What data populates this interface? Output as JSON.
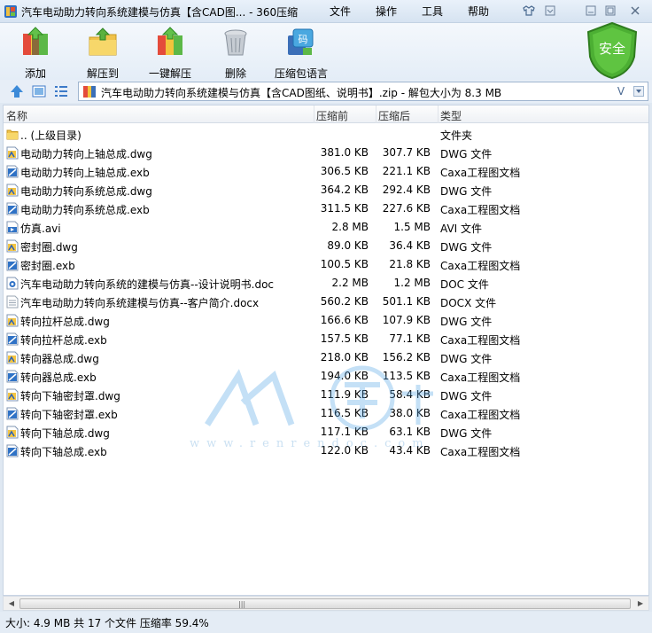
{
  "window": {
    "title": "汽车电动助力转向系统建模与仿真【含CAD图... - 360压缩",
    "menu": [
      "文件",
      "操作",
      "工具",
      "帮助"
    ]
  },
  "toolbar": {
    "buttons": [
      {
        "label": "添加",
        "icon": "add-archive-icon"
      },
      {
        "label": "解压到",
        "icon": "extract-to-icon"
      },
      {
        "label": "一键解压",
        "icon": "one-click-extract-icon"
      },
      {
        "label": "删除",
        "icon": "delete-icon"
      },
      {
        "label": "压缩包语言",
        "icon": "archive-language-icon"
      }
    ],
    "safe_badge": "安全"
  },
  "address": {
    "path": "汽车电动助力转向系统建模与仿真【含CAD图纸、说明书】.zip - 解包大小为 8.3 MB",
    "dropdown": "V"
  },
  "columns": {
    "name": "名称",
    "packed": "压缩前",
    "compressed": "压缩后",
    "type": "类型"
  },
  "files": [
    {
      "name": ".. (上级目录)",
      "packed": "",
      "compressed": "",
      "type": "文件夹",
      "kind": "folder"
    },
    {
      "name": "电动助力转向上轴总成.dwg",
      "packed": "381.0 KB",
      "compressed": "307.7 KB",
      "type": "DWG 文件",
      "kind": "dwg"
    },
    {
      "name": "电动助力转向上轴总成.exb",
      "packed": "306.5 KB",
      "compressed": "221.1 KB",
      "type": "Caxa工程图文档",
      "kind": "exb"
    },
    {
      "name": "电动助力转向系统总成.dwg",
      "packed": "364.2 KB",
      "compressed": "292.4 KB",
      "type": "DWG 文件",
      "kind": "dwg"
    },
    {
      "name": "电动助力转向系统总成.exb",
      "packed": "311.5 KB",
      "compressed": "227.6 KB",
      "type": "Caxa工程图文档",
      "kind": "exb"
    },
    {
      "name": "仿真.avi",
      "packed": "2.8 MB",
      "compressed": "1.5 MB",
      "type": "AVI 文件",
      "kind": "avi"
    },
    {
      "name": "密封圈.dwg",
      "packed": "89.0 KB",
      "compressed": "36.4 KB",
      "type": "DWG 文件",
      "kind": "dwg"
    },
    {
      "name": "密封圈.exb",
      "packed": "100.5 KB",
      "compressed": "21.8 KB",
      "type": "Caxa工程图文档",
      "kind": "exb"
    },
    {
      "name": "汽车电动助力转向系统的建模与仿真--设计说明书.doc",
      "packed": "2.2 MB",
      "compressed": "1.2 MB",
      "type": "DOC 文件",
      "kind": "doc"
    },
    {
      "name": "汽车电动助力转向系统建模与仿真--客户简介.docx",
      "packed": "560.2 KB",
      "compressed": "501.1 KB",
      "type": "DOCX 文件",
      "kind": "docx"
    },
    {
      "name": "转向拉杆总成.dwg",
      "packed": "166.6 KB",
      "compressed": "107.9 KB",
      "type": "DWG 文件",
      "kind": "dwg"
    },
    {
      "name": "转向拉杆总成.exb",
      "packed": "157.5 KB",
      "compressed": "77.1 KB",
      "type": "Caxa工程图文档",
      "kind": "exb"
    },
    {
      "name": "转向器总成.dwg",
      "packed": "218.0 KB",
      "compressed": "156.2 KB",
      "type": "DWG 文件",
      "kind": "dwg"
    },
    {
      "name": "转向器总成.exb",
      "packed": "194.0 KB",
      "compressed": "113.5 KB",
      "type": "Caxa工程图文档",
      "kind": "exb"
    },
    {
      "name": "转向下轴密封罩.dwg",
      "packed": "111.9 KB",
      "compressed": "58.4 KB",
      "type": "DWG 文件",
      "kind": "dwg"
    },
    {
      "name": "转向下轴密封罩.exb",
      "packed": "116.5 KB",
      "compressed": "38.0 KB",
      "type": "Caxa工程图文档",
      "kind": "exb"
    },
    {
      "name": "转向下轴总成.dwg",
      "packed": "117.1 KB",
      "compressed": "63.1 KB",
      "type": "DWG 文件",
      "kind": "dwg"
    },
    {
      "name": "转向下轴总成.exb",
      "packed": "122.0 KB",
      "compressed": "43.4 KB",
      "type": "Caxa工程图文档",
      "kind": "exb"
    }
  ],
  "watermark": {
    "text": "www.renrendoc.com"
  },
  "status": {
    "text": "大小: 4.9 MB 共 17 个文件 压缩率 59.4%"
  },
  "colors": {
    "accent": "#2a7fd4",
    "safe_green": "#3f9e2c",
    "folder": "#e8c34a"
  }
}
